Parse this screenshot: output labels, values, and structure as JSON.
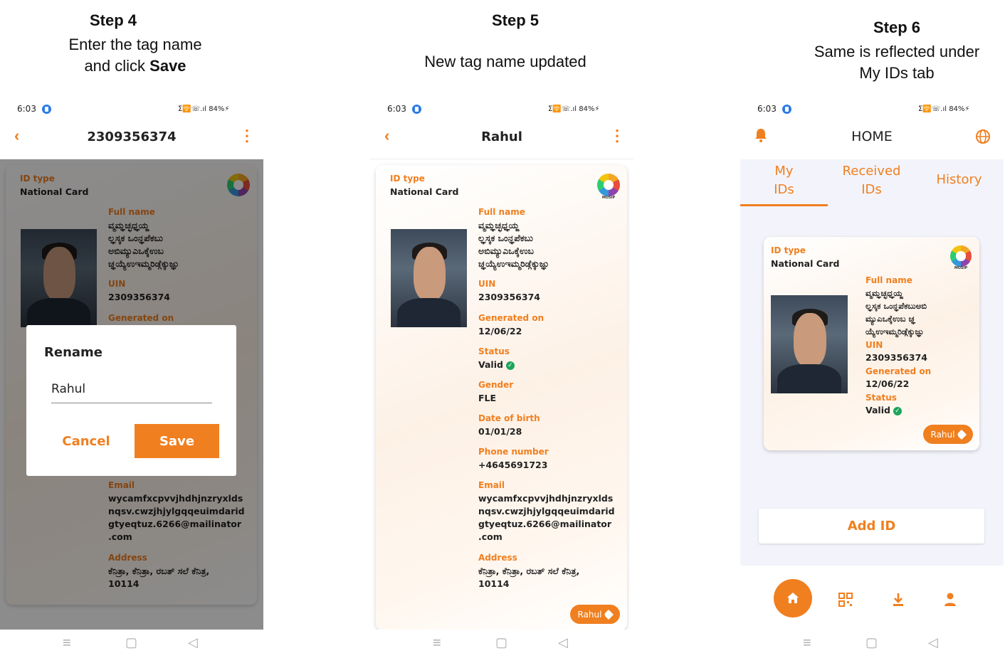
{
  "captions": {
    "step4": {
      "heading": "Step 4",
      "line1": "Enter the tag name",
      "line2_prefix": "and click ",
      "line2_bold": "Save"
    },
    "step5": {
      "heading": "Step 5",
      "line1": "New tag name updated"
    },
    "step6": {
      "heading": "Step 6",
      "line1": "Same is reflected under",
      "line2": "My IDs tab"
    }
  },
  "status_bar": {
    "time": "6:03",
    "right": "ⵉ🛜☏.ıl 84%⚡"
  },
  "card": {
    "id_type_label": "ID type",
    "id_type_value": "National Card",
    "logo_text": "MOSIP",
    "full_name_label": "Full name",
    "full_name_lines": [
      "ವ್ಮಮ್ಞಚ್ಛಧ್ಞಯ್ಙ",
      "ಲ್ಞಸ್ಕಕ ಒಂನ್ಞಪೆಕಬು",
      "ಅಬಿಮ್ಯುಎಒಕ್ಕೆಉಬ",
      "ಚ್ಞಯ್ಯೆಉಇಮ್ಮರಿಡ್ಗೆಕ್ಕುಜ್ಞು"
    ],
    "full_name_lines_home": [
      "ವ್ಮಮ್ಞಚ್ಛಧ್ಞಯ್ಙ",
      "ಲ್ಞಸ್ಕಕ ಒಂನ್ಞಪೆಕಬುಅಬಿ",
      "ಮ್ಯುಎಒಕ್ಕೆಉಬ ಚ್ಞ",
      "ಯ್ಯೆಉಇಮ್ಮರಿಡ್ಗೆಕ್ಕುಜ್ಞು"
    ],
    "uin_label": "UIN",
    "uin_value": "2309356374",
    "generated_label": "Generated on",
    "generated_value": "12/06/22",
    "status_label": "Status",
    "status_value": "Valid",
    "gender_label": "Gender",
    "gender_value": "FLE",
    "dob_label": "Date of birth",
    "dob_value": "01/01/28",
    "phone_label": "Phone number",
    "phone_value": "+4645691723",
    "email_label": "Email",
    "email_lines": [
      "wycamfxcpvvjhdhjnzryxlds",
      "nqsv.cwzjhjylgqqeuimdarid",
      "gtyeqtuz.6266@mailinator",
      ".com"
    ],
    "address_label": "Address",
    "address_lines": [
      "ಕೆನಿತ್ರಾ, ಕೆನಿತ್ರಾ, ರಬತ್ ಸಲೆ ಕೆನಿತ್ರ,",
      "10114"
    ],
    "tag": "Rahul"
  },
  "screen4": {
    "title": "2309356374",
    "dialog": {
      "title": "Rename",
      "input_value": "Rahul",
      "cancel": "Cancel",
      "save": "Save"
    }
  },
  "screen5": {
    "title": "Rahul"
  },
  "screen6": {
    "title": "HOME",
    "tabs": [
      {
        "line1": "My",
        "line2": "IDs"
      },
      {
        "line1": "Received",
        "line2": "IDs"
      },
      {
        "line1": "History"
      }
    ],
    "add_id": "Add ID"
  },
  "nav_glyphs": {
    "menu": "≡",
    "home": "▢",
    "back": "◁"
  },
  "colors": {
    "accent": "#f07f1f",
    "valid": "#1ca55a"
  }
}
